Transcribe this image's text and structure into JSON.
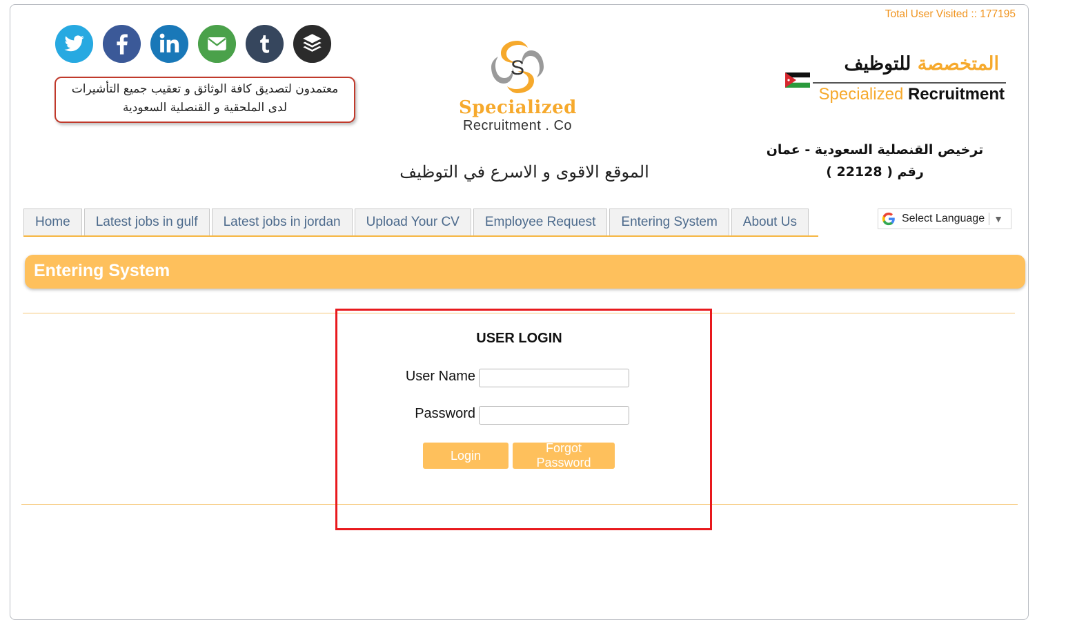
{
  "header": {
    "visit_counter": "Total User Visited :: 177195",
    "social_icons": [
      "twitter-icon",
      "facebook-icon",
      "linkedin-icon",
      "email-icon",
      "tumblr-icon",
      "buffer-icon"
    ],
    "accredit_line1": "معتمدون لتصديق كافة الوثائق و تعقيب جميع التأشيرات",
    "accredit_line2": "لدى الملحقية و القنصلية السعودية",
    "logo_center_mark": "S",
    "logo_center_name": "Specialized",
    "logo_center_sub": "Recruitment . Co",
    "tagline": "الموقع الاقوى و الاسرع في التوظيف",
    "logo_right_ar_orange": "المتخصصة",
    "logo_right_ar_dark": "للتوظيف",
    "logo_right_en_orange": "Specialized",
    "logo_right_en_dark": "Recruitment",
    "license_line1": "ترخيص القنصلية السعودية - عمان",
    "license_line2": "رقم ( 22128 )"
  },
  "nav": {
    "tabs": [
      {
        "label": "Home"
      },
      {
        "label": "Latest jobs in gulf"
      },
      {
        "label": "Latest jobs in jordan"
      },
      {
        "label": "Upload Your CV"
      },
      {
        "label": "Employee Request"
      },
      {
        "label": "Entering System"
      },
      {
        "label": "About Us"
      }
    ]
  },
  "language": {
    "label": "Select Language"
  },
  "page_header": {
    "title": "Entering System"
  },
  "login": {
    "title": "USER LOGIN",
    "username_label": "User Name",
    "username_value": "",
    "password_label": "Password",
    "password_value": "",
    "login_button": "Login",
    "forgot_button": "Forgot Password"
  },
  "colors": {
    "accent": "#fec05c",
    "visit_text": "#f0931d",
    "tab_text": "#4c6a8c",
    "highlight_box": "#e8191d"
  }
}
